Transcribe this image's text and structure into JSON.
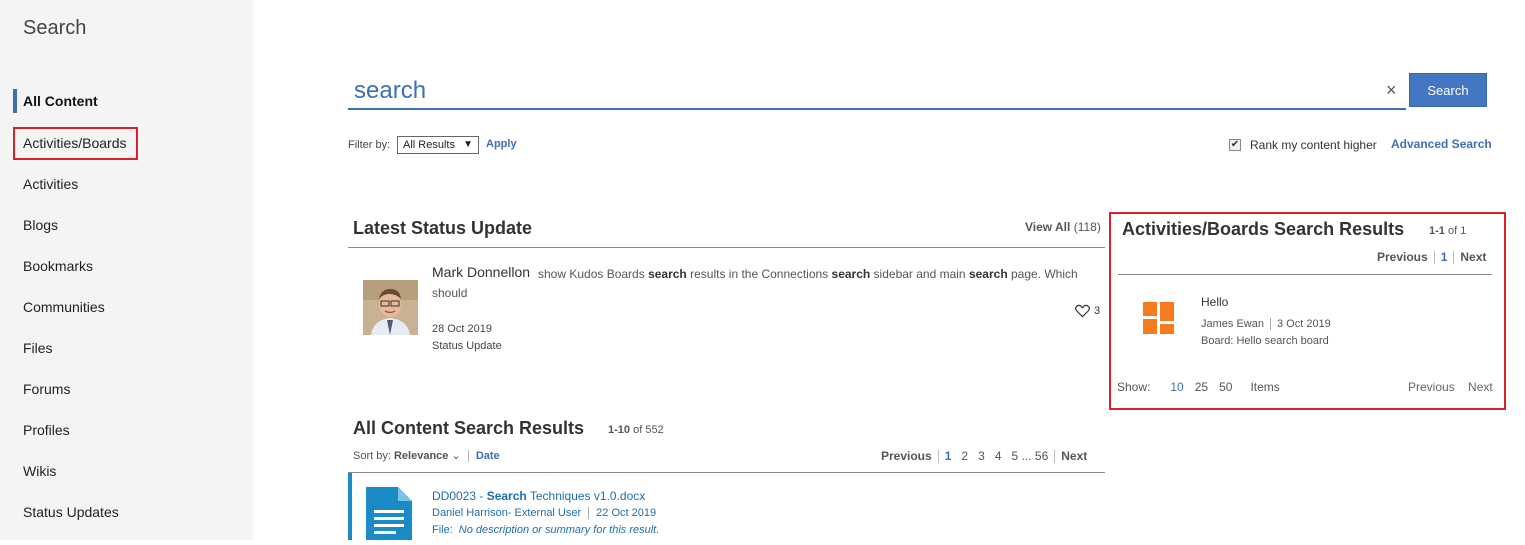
{
  "sidebar": {
    "title": "Search",
    "items": [
      {
        "label": "All Content"
      },
      {
        "label": "Activities/Boards"
      },
      {
        "label": "Activities"
      },
      {
        "label": "Blogs"
      },
      {
        "label": "Bookmarks"
      },
      {
        "label": "Communities"
      },
      {
        "label": "Files"
      },
      {
        "label": "Forums"
      },
      {
        "label": "Profiles"
      },
      {
        "label": "Wikis"
      },
      {
        "label": "Status Updates"
      }
    ]
  },
  "search": {
    "value": "search",
    "clear": "×",
    "button_label": "Search"
  },
  "filter": {
    "label": "Filter by:",
    "selected": "All Results",
    "apply": "Apply",
    "rank_label": "Rank my content higher",
    "rank_checked": true,
    "advanced": "Advanced Search"
  },
  "status_section": {
    "title": "Latest Status Update",
    "view_all": "View All",
    "view_all_count": "(118)",
    "author": "Mark Donnellon",
    "text_parts": [
      "show Kudos Boards ",
      "search",
      " results in the Connections ",
      "search",
      " sidebar and main ",
      "search",
      " page. Which should"
    ],
    "date": "28 Oct 2019",
    "type": "Status Update",
    "likes": "3"
  },
  "all_content": {
    "title": "All Content Search Results",
    "range": "1-10",
    "of_total": "of 552",
    "sort_label": "Sort by:",
    "sort_relevance": "Relevance",
    "sort_date": "Date",
    "pager": {
      "previous": "Previous",
      "pages": [
        "1",
        "2",
        "3",
        "4",
        "5",
        "...",
        "56"
      ],
      "next": "Next"
    },
    "results": [
      {
        "id_prefix": "DD0023 - ",
        "highlight": "Search",
        "title_rest": " Techniques v1.0.docx",
        "author": "Daniel Harrison- External User",
        "date": "22 Oct 2019",
        "file_label": "File:",
        "summary": "No description or summary for this result."
      }
    ]
  },
  "boards_panel": {
    "title": "Activities/Boards Search Results",
    "range": "1-1",
    "of_total": "of 1",
    "pager": {
      "previous": "Previous",
      "page": "1",
      "next": "Next"
    },
    "result": {
      "title": "Hello",
      "author": "James Ewan",
      "date": "3 Oct 2019",
      "board": "Board: Hello search board"
    },
    "show_label": "Show:",
    "sizes": [
      "10",
      "25",
      "50"
    ],
    "items_label": "Items",
    "bottom_previous": "Previous",
    "bottom_next": "Next",
    "icon_color": "#f47b20",
    "highlight_color": "#d9212a"
  }
}
